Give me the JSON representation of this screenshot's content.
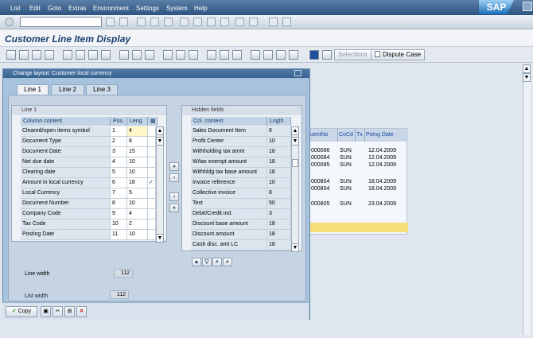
{
  "menu": {
    "items": [
      "List",
      "Edit",
      "Goto",
      "Extras",
      "Environment",
      "Settings",
      "System",
      "Help"
    ],
    "logo": "SAP"
  },
  "title": "Customer Line Item Display",
  "toolbar2": {
    "selections_label": "Selections",
    "dispute_label": "Dispute Case"
  },
  "dialog": {
    "title": "Change layout: Customer local currency",
    "tabs": [
      "Line 1",
      "Line 2",
      "Line 3"
    ],
    "line1": {
      "group_title": "Line 1",
      "headers": [
        "Column content",
        "Pos.",
        "Leng"
      ],
      "rows": [
        {
          "content": "Cleared/open items symbol",
          "pos": "1",
          "len": "4",
          "check": false
        },
        {
          "content": "Document Type",
          "pos": "2",
          "len": "8",
          "check": false
        },
        {
          "content": "Document Date",
          "pos": "3",
          "len": "15",
          "check": false
        },
        {
          "content": "Net due date",
          "pos": "4",
          "len": "10",
          "check": false
        },
        {
          "content": "Clearing date",
          "pos": "5",
          "len": "10",
          "check": false
        },
        {
          "content": "Amount in local currency",
          "pos": "6",
          "len": "18",
          "check": true
        },
        {
          "content": "Local Currency",
          "pos": "7",
          "len": "5",
          "check": false
        },
        {
          "content": "Document Number",
          "pos": "8",
          "len": "10",
          "check": false
        },
        {
          "content": "Company Code",
          "pos": "9",
          "len": "4",
          "check": false
        },
        {
          "content": "Tax Code",
          "pos": "10",
          "len": "2",
          "check": false
        },
        {
          "content": "Posting Date",
          "pos": "11",
          "len": "10",
          "check": false
        }
      ]
    },
    "hidden": {
      "group_title": "Hidden fields",
      "headers": [
        "Col. content",
        "Lngth"
      ],
      "rows": [
        {
          "content": "Sales Document Item",
          "len": "6"
        },
        {
          "content": "Profit Center",
          "len": "10"
        },
        {
          "content": "Withholding tax amnt",
          "len": "18"
        },
        {
          "content": "W/tax exempt amount",
          "len": "18"
        },
        {
          "content": "Withhldg tax base amount",
          "len": "18"
        },
        {
          "content": "Invoice reference",
          "len": "10"
        },
        {
          "content": "Collective invoice",
          "len": "8"
        },
        {
          "content": "Text",
          "len": "50"
        },
        {
          "content": "Debit/Credit ind.",
          "len": "3"
        },
        {
          "content": "Discount base amount",
          "len": "18"
        },
        {
          "content": "Discount amount",
          "len": "18"
        },
        {
          "content": "Cash disc. amt LC",
          "len": "18"
        }
      ]
    },
    "line_width_label": "Line width",
    "line_width_value": "112",
    "list_width_label": "List width",
    "list_width_value": "112",
    "copy_label": "Copy"
  },
  "bg_table": {
    "headers": [
      "uentNo",
      "CoCd",
      "Tx",
      "Pstng Date"
    ],
    "rows": [
      {
        "no": "000086",
        "cocd": "SUN",
        "date": "12.04.2009"
      },
      {
        "no": "000084",
        "cocd": "SUN",
        "date": "12.04.2009"
      },
      {
        "no": "000085",
        "cocd": "SUN",
        "date": "12.04.2009"
      },
      {
        "no": "",
        "cocd": "",
        "date": ""
      },
      {
        "no": "000804",
        "cocd": "SUN",
        "date": "18.04.2009"
      },
      {
        "no": "000804",
        "cocd": "SUN",
        "date": "18.04.2009"
      },
      {
        "no": "",
        "cocd": "",
        "date": ""
      },
      {
        "no": "000805",
        "cocd": "SUN",
        "date": "23.04.2009"
      }
    ]
  }
}
